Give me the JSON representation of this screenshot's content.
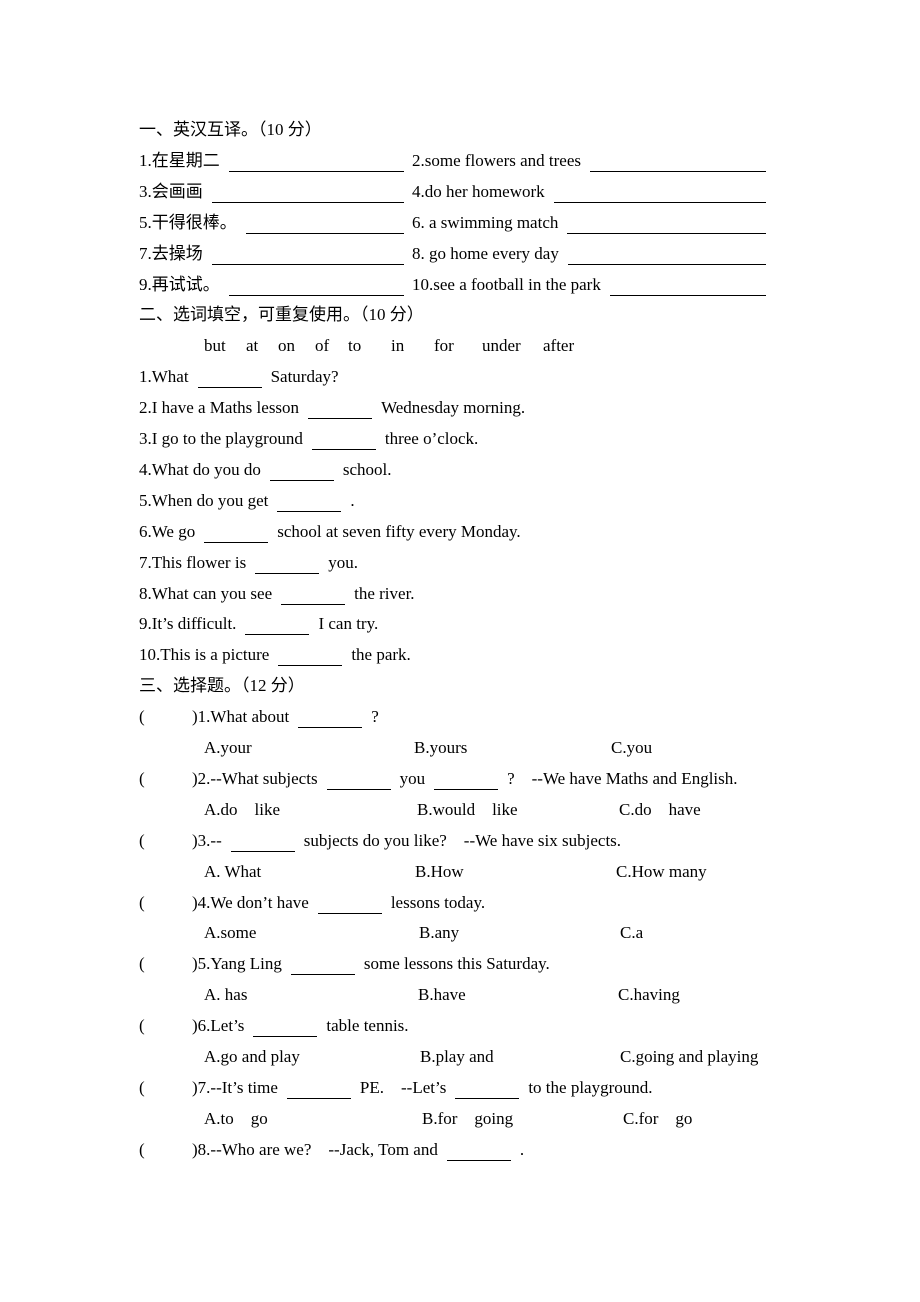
{
  "section1": {
    "heading": "一、英汉互译。（10 分）",
    "items": [
      [
        "1.在星期二",
        "2.some flowers and trees"
      ],
      [
        "3.会画画",
        "4.do her homework"
      ],
      [
        "5.干得很棒。",
        "6. a swimming match"
      ],
      [
        "7.去操场",
        "8. go home every day"
      ],
      [
        "9.再试试。",
        "10.see a football in the park"
      ]
    ]
  },
  "section2": {
    "heading": "二、选词填空，可重复使用。（10 分）",
    "word_bank": [
      "but",
      "at",
      "on",
      "of",
      "to",
      "in",
      "for",
      "under",
      "after"
    ],
    "questions": [
      [
        "1.What",
        "",
        "Saturday?"
      ],
      [
        "2.I have a Maths lesson",
        "",
        "Wednesday morning."
      ],
      [
        "3.I go to the playground",
        "",
        "three o’clock."
      ],
      [
        "4.What do you do",
        "",
        "school."
      ],
      [
        "5.When do you get",
        "",
        "."
      ],
      [
        "6.We go",
        "",
        "school at seven fifty every Monday."
      ],
      [
        "7.This flower is",
        "",
        "you."
      ],
      [
        "8.What can you see",
        "",
        "the river."
      ],
      [
        "9.It’s difficult.",
        "",
        "I can try."
      ],
      [
        "10.This is a picture",
        "",
        "the park."
      ]
    ]
  },
  "section3": {
    "heading": "三、选择题。（12 分）",
    "bracket_open": "(",
    "questions": [
      {
        "parts": [
          ")1.What about",
          "",
          "?"
        ],
        "options": [
          "A.your",
          "B.yours",
          "C.you"
        ]
      },
      {
        "parts": [
          ")2.--What subjects",
          "",
          "you",
          "",
          "?    --We have Maths and English."
        ],
        "options": [
          "A.do    like",
          "B.would    like",
          "C.do    have"
        ]
      },
      {
        "parts": [
          ")3.--",
          "",
          "subjects do you like?    --We have six subjects."
        ],
        "options": [
          "A. What",
          "B.How",
          "C.How many"
        ]
      },
      {
        "parts": [
          ")4.We don’t have",
          "",
          "lessons today."
        ],
        "options": [
          "A.some",
          "B.any",
          "C.a"
        ]
      },
      {
        "parts": [
          ")5.Yang Ling",
          "",
          "some lessons this Saturday."
        ],
        "options": [
          "A. has",
          "B.have",
          "C.having"
        ]
      },
      {
        "parts": [
          ")6.Let’s",
          "",
          "table tennis."
        ],
        "options": [
          "A.go and play",
          "B.play and",
          "C.going and playing"
        ]
      },
      {
        "parts": [
          ")7.--It’s time",
          "",
          "PE.    --Let’s",
          "",
          "to the playground."
        ],
        "options": [
          "A.to    go",
          "B.for    going",
          "C.for    go"
        ]
      },
      {
        "parts": [
          ")8.--Who are we?    --Jack, Tom and",
          "",
          "."
        ],
        "options": []
      }
    ]
  }
}
